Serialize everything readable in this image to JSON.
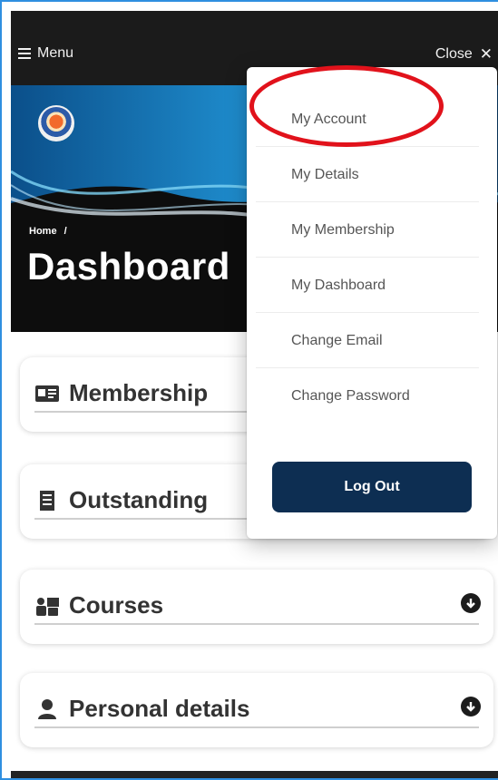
{
  "header": {
    "menu_label": "Menu",
    "close_label": "Close",
    "close_glyph": "✕"
  },
  "hero": {
    "breadcrumb_home": "Home",
    "breadcrumb_sep": "/",
    "title": "Dashboard"
  },
  "cards": [
    {
      "title": "Membership",
      "icon": "id-card-icon"
    },
    {
      "title": "Outstanding",
      "icon": "receipt-icon"
    },
    {
      "title": "Courses",
      "icon": "chalkboard-teacher-icon",
      "expand_icon": "circle-arrow-down-icon"
    },
    {
      "title": "Personal details",
      "icon": "user-icon",
      "expand_icon": "circle-arrow-down-icon"
    }
  ],
  "dropdown": {
    "items": [
      "My Account",
      "My Details",
      "My Membership",
      "My Dashboard",
      "Change Email",
      "Change Password"
    ],
    "logout_label": "Log Out"
  },
  "colors": {
    "topbar": "#1b1b1b",
    "logout_button": "#0d2e52",
    "annotation_ring": "#e1121b",
    "frame_border": "#2f8fe0"
  }
}
